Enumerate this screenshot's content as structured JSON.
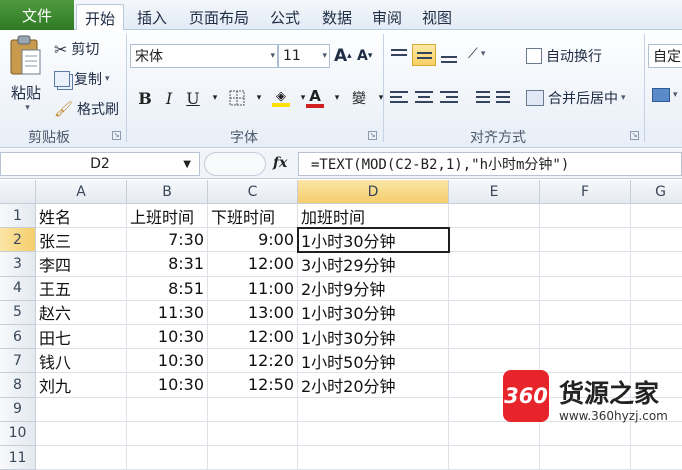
{
  "tabs": {
    "file": "文件",
    "items": [
      "开始",
      "插入",
      "页面布局",
      "公式",
      "数据",
      "审阅",
      "视图"
    ],
    "active": "开始"
  },
  "ribbon": {
    "clipboard": {
      "paste": "粘贴",
      "cut": "剪切",
      "copy": "复制",
      "format_painter": "格式刷",
      "label": "剪贴板"
    },
    "font": {
      "name": "宋体",
      "size": "11",
      "bold": "B",
      "italic": "I",
      "underline": "U",
      "grow": "A",
      "shrink": "A",
      "label": "字体",
      "font_color": "#d02020",
      "fill_color": "#ffe000"
    },
    "alignment": {
      "wrap_text": "自动换行",
      "merge_center": "合并后居中",
      "label": "对齐方式"
    },
    "number": {
      "format": "自定"
    }
  },
  "formula_bar": {
    "name_box": "D2",
    "fx": "fx",
    "formula": "=TEXT(MOD(C2-B2,1),\"h小时m分钟\")"
  },
  "sheet": {
    "columns": [
      "A",
      "B",
      "C",
      "D",
      "E",
      "F",
      "G"
    ],
    "selected_column": "D",
    "selected_row": "2",
    "rows": [
      {
        "num": "1",
        "a": "姓名",
        "b": "上班时间",
        "c": "下班时间",
        "d": "加班时间"
      },
      {
        "num": "2",
        "a": "张三",
        "b": "7:30",
        "c": "9:00",
        "d": "1小时30分钟"
      },
      {
        "num": "3",
        "a": "李四",
        "b": "8:31",
        "c": "12:00",
        "d": "3小时29分钟"
      },
      {
        "num": "4",
        "a": "王五",
        "b": "8:51",
        "c": "11:00",
        "d": "2小时9分钟"
      },
      {
        "num": "5",
        "a": "赵六",
        "b": "11:30",
        "c": "13:00",
        "d": "1小时30分钟"
      },
      {
        "num": "6",
        "a": "田七",
        "b": "10:30",
        "c": "12:00",
        "d": "1小时30分钟"
      },
      {
        "num": "7",
        "a": "钱八",
        "b": "10:30",
        "c": "12:20",
        "d": "1小时50分钟"
      },
      {
        "num": "8",
        "a": "刘九",
        "b": "10:30",
        "c": "12:50",
        "d": "2小时20分钟"
      },
      {
        "num": "9",
        "a": "",
        "b": "",
        "c": "",
        "d": ""
      },
      {
        "num": "10",
        "a": "",
        "b": "",
        "c": "",
        "d": ""
      },
      {
        "num": "11",
        "a": "",
        "b": "",
        "c": "",
        "d": ""
      }
    ]
  },
  "watermark": {
    "logo": "360",
    "name": "货源之家",
    "url": "www.360hyzj.com"
  }
}
